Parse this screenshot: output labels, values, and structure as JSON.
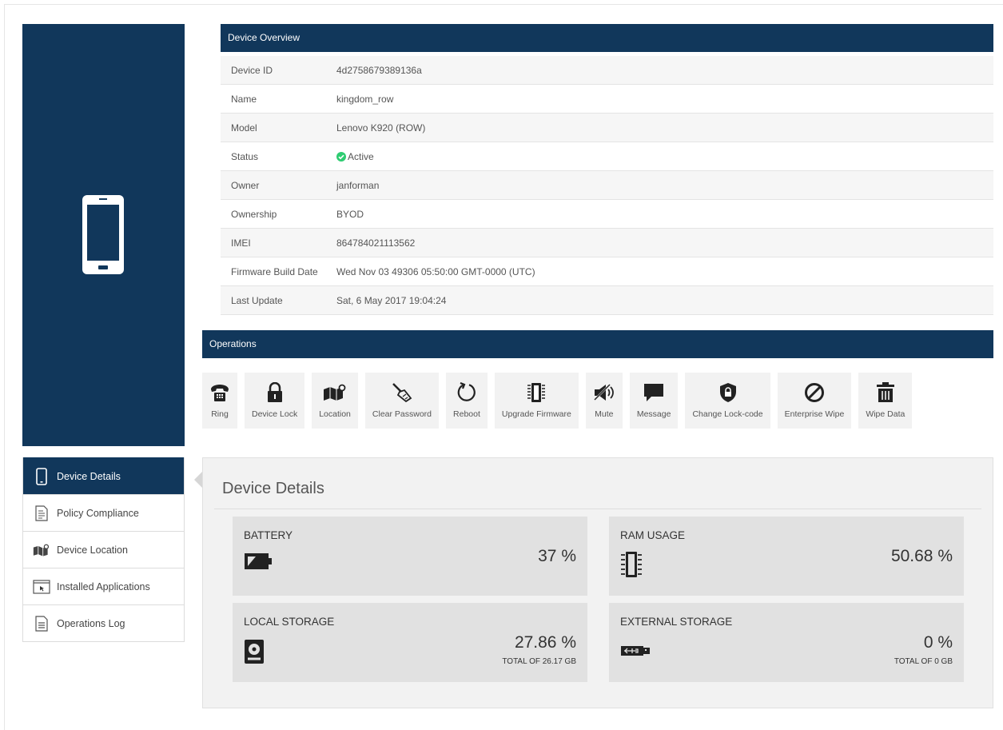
{
  "overview": {
    "title": "Device Overview",
    "rows": [
      {
        "key": "Device ID",
        "value": "4d2758679389136a"
      },
      {
        "key": "Name",
        "value": "kingdom_row"
      },
      {
        "key": "Model",
        "value": "Lenovo K920 (ROW)"
      },
      {
        "key": "Status",
        "value": "Active"
      },
      {
        "key": "Owner",
        "value": "janforman"
      },
      {
        "key": "Ownership",
        "value": "BYOD"
      },
      {
        "key": "IMEI",
        "value": "864784021113562"
      },
      {
        "key": "Firmware Build Date",
        "value": "Wed Nov 03 49306 05:50:00 GMT-0000 (UTC)"
      },
      {
        "key": "Last Update",
        "value": "Sat, 6 May 2017 19:04:24"
      }
    ]
  },
  "operations": {
    "title": "Operations",
    "items": [
      {
        "label": "Ring",
        "icon": "phone-icon"
      },
      {
        "label": "Device Lock",
        "icon": "lock-icon"
      },
      {
        "label": "Location",
        "icon": "map-icon"
      },
      {
        "label": "Clear Password",
        "icon": "broom-icon"
      },
      {
        "label": "Reboot",
        "icon": "reboot-icon"
      },
      {
        "label": "Upgrade Firmware",
        "icon": "chip-icon"
      },
      {
        "label": "Mute",
        "icon": "mute-icon"
      },
      {
        "label": "Message",
        "icon": "message-icon"
      },
      {
        "label": "Change Lock-code",
        "icon": "shield-lock-icon"
      },
      {
        "label": "Enterprise Wipe",
        "icon": "ban-icon"
      },
      {
        "label": "Wipe Data",
        "icon": "trash-icon"
      }
    ]
  },
  "nav": {
    "items": [
      {
        "label": "Device Details",
        "icon": "mobile-icon",
        "active": true
      },
      {
        "label": "Policy Compliance",
        "icon": "document-icon"
      },
      {
        "label": "Device Location",
        "icon": "map-icon"
      },
      {
        "label": "Installed Applications",
        "icon": "window-icon"
      },
      {
        "label": "Operations Log",
        "icon": "list-icon"
      }
    ]
  },
  "details": {
    "title": "Device Details",
    "cards": [
      {
        "title": "BATTERY",
        "value": "37 %",
        "sub": "",
        "icon": "battery-icon"
      },
      {
        "title": "RAM USAGE",
        "value": "50.68 %",
        "sub": "",
        "icon": "chip-icon"
      },
      {
        "title": "LOCAL STORAGE",
        "value": "27.86 %",
        "sub": "TOTAL OF 26.17 GB",
        "icon": "hdd-icon"
      },
      {
        "title": "EXTERNAL STORAGE",
        "value": "0 %",
        "sub": "TOTAL OF 0 GB",
        "icon": "usb-icon"
      }
    ]
  },
  "colors": {
    "primary": "#11375b",
    "status_ok": "#2ecc71"
  }
}
